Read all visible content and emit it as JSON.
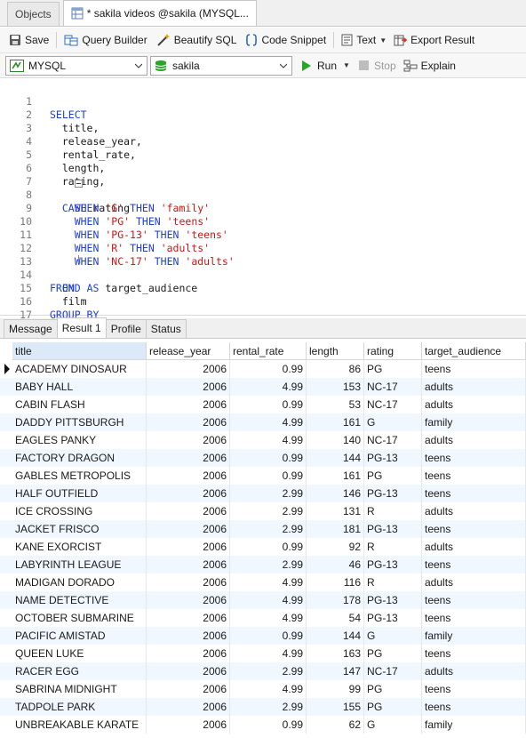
{
  "tabs": {
    "objects": "Objects",
    "query": "* sakila videos @sakila (MYSQL..."
  },
  "toolbar": {
    "save": "Save",
    "query_builder": "Query Builder",
    "beautify": "Beautify SQL",
    "snippet": "Code Snippet",
    "text": "Text",
    "export": "Export Result"
  },
  "connection": {
    "server": "MYSQL",
    "database": "sakila",
    "run": "Run",
    "stop": "Stop",
    "explain": "Explain"
  },
  "editor": {
    "line_numbers": [
      "1",
      "2",
      "3",
      "4",
      "5",
      "6",
      "7",
      "8",
      "9",
      "10",
      "11",
      "12",
      "13",
      "14",
      "15",
      "16",
      "17"
    ]
  },
  "result_tabs": [
    "Message",
    "Result 1",
    "Profile",
    "Status"
  ],
  "grid": {
    "columns": [
      "title",
      "release_year",
      "rental_rate",
      "length",
      "rating",
      "target_audience"
    ],
    "rows": [
      [
        "ACADEMY DINOSAUR",
        "2006",
        "0.99",
        "86",
        "PG",
        "teens"
      ],
      [
        "BABY HALL",
        "2006",
        "4.99",
        "153",
        "NC-17",
        "adults"
      ],
      [
        "CABIN FLASH",
        "2006",
        "0.99",
        "53",
        "NC-17",
        "adults"
      ],
      [
        "DADDY PITTSBURGH",
        "2006",
        "4.99",
        "161",
        "G",
        "family"
      ],
      [
        "EAGLES PANKY",
        "2006",
        "4.99",
        "140",
        "NC-17",
        "adults"
      ],
      [
        "FACTORY DRAGON",
        "2006",
        "0.99",
        "144",
        "PG-13",
        "teens"
      ],
      [
        "GABLES METROPOLIS",
        "2006",
        "0.99",
        "161",
        "PG",
        "teens"
      ],
      [
        "HALF OUTFIELD",
        "2006",
        "2.99",
        "146",
        "PG-13",
        "teens"
      ],
      [
        "ICE CROSSING",
        "2006",
        "2.99",
        "131",
        "R",
        "adults"
      ],
      [
        "JACKET FRISCO",
        "2006",
        "2.99",
        "181",
        "PG-13",
        "teens"
      ],
      [
        "KANE EXORCIST",
        "2006",
        "0.99",
        "92",
        "R",
        "adults"
      ],
      [
        "LABYRINTH LEAGUE",
        "2006",
        "2.99",
        "46",
        "PG-13",
        "teens"
      ],
      [
        "MADIGAN DORADO",
        "2006",
        "4.99",
        "116",
        "R",
        "adults"
      ],
      [
        "NAME DETECTIVE",
        "2006",
        "4.99",
        "178",
        "PG-13",
        "teens"
      ],
      [
        "OCTOBER SUBMARINE",
        "2006",
        "4.99",
        "54",
        "PG-13",
        "teens"
      ],
      [
        "PACIFIC AMISTAD",
        "2006",
        "0.99",
        "144",
        "G",
        "family"
      ],
      [
        "QUEEN LUKE",
        "2006",
        "4.99",
        "163",
        "PG",
        "teens"
      ],
      [
        "RACER EGG",
        "2006",
        "2.99",
        "147",
        "NC-17",
        "adults"
      ],
      [
        "SABRINA MIDNIGHT",
        "2006",
        "4.99",
        "99",
        "PG",
        "teens"
      ],
      [
        "TADPOLE PARK",
        "2006",
        "2.99",
        "155",
        "PG",
        "teens"
      ],
      [
        "UNBREAKABLE KARATE",
        "2006",
        "0.99",
        "62",
        "G",
        "family"
      ]
    ]
  }
}
